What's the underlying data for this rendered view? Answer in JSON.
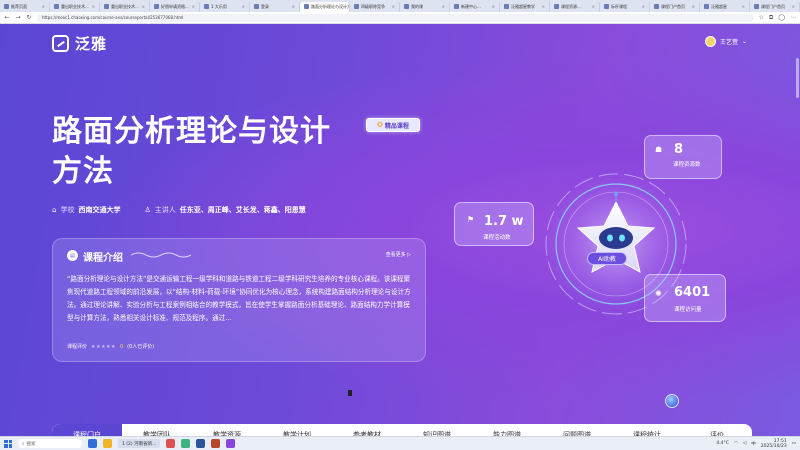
{
  "browser": {
    "tabs": [
      {
        "label": "推荐页面",
        "active": false
      },
      {
        "label": "重出职业技术...",
        "active": false
      },
      {
        "label": "重出职业技术...",
        "active": false
      },
      {
        "label": "好朋申请资格...",
        "active": false
      },
      {
        "label": "1 大乐用",
        "active": false
      },
      {
        "label": "登录",
        "active": false
      },
      {
        "label": "路面分析理论与设计方法",
        "active": true
      },
      {
        "label": "四级职称竞争",
        "active": false
      },
      {
        "label": "我的课",
        "active": false
      },
      {
        "label": "新建中心...",
        "active": false
      },
      {
        "label": "泛雅超星教学",
        "active": false
      },
      {
        "label": "课程资源...",
        "active": false
      },
      {
        "label": "标杆课程",
        "active": false
      },
      {
        "label": "课程门户首页",
        "active": false
      },
      {
        "label": "泛雅超星",
        "active": false
      },
      {
        "label": "课程门户首页",
        "active": false
      }
    ],
    "new_tab": "+",
    "url": "https://mooc1.chaoxing.com/course-ans/courseportal/253677068.html"
  },
  "header": {
    "brand": "泛雅",
    "user_name": "王艺萱",
    "chevron": "⌄"
  },
  "course": {
    "title": "路面分析理论与设计方法",
    "badge": "精品课程",
    "school_label": "学校",
    "school": "西南交通大学",
    "lecturer_label": "主讲人",
    "lecturers": "任东亚、周正峰、艾长发、蒋鑫、阳恩慧"
  },
  "intro": {
    "title": "课程介绍",
    "see_more": "查看更多 ▷",
    "text": "“路面分析理论与设计方法”是交通运输工程一级学科和道路与铁道工程二级学科研究生培养的专业核心课程。该课程聚焦现代道路工程领域的前沿发展，以“结构-材料-荷载-环境”协同优化为核心理念，系统构建路面结构分析理论与设计方法。通过理论讲解、实验分析与工程案例相结合的教学模式，旨在使学生掌握路面分析基础理论、路面结构力学计算模型与计算方法，熟悉相关设计标准、规范及程序。通过...",
    "rating_label": "课程评价",
    "rating_stars": "★★★★★",
    "rating_score": "0",
    "rating_count": "(0人已评价)"
  },
  "stats": {
    "resources": {
      "value": "8",
      "label": "课程资源数"
    },
    "activity": {
      "value": "1.7 w",
      "label": "课程活动数"
    },
    "visits": {
      "value": "6401",
      "label": "课程访问量"
    },
    "ai_label": "AI助教"
  },
  "nav": {
    "tabs": [
      "课程门户",
      "教学团队",
      "教学资源",
      "教学计划",
      "参考教材",
      "知识图谱",
      "能力图谱",
      "问题图谱",
      "课程统计",
      "评价"
    ]
  },
  "taskbar": {
    "search_placeholder": "搜索",
    "window_label": "1 (2) 河南省新...",
    "clock_time": "17:51",
    "clock_date": "2025/10/23",
    "lang": "中",
    "weather": "4.4°C"
  },
  "colors": {
    "primary": "#5b46d4",
    "accent_purple": "#8a46dc",
    "badge_text": "#5b3ec9",
    "star_yellow": "#ffd45c"
  }
}
